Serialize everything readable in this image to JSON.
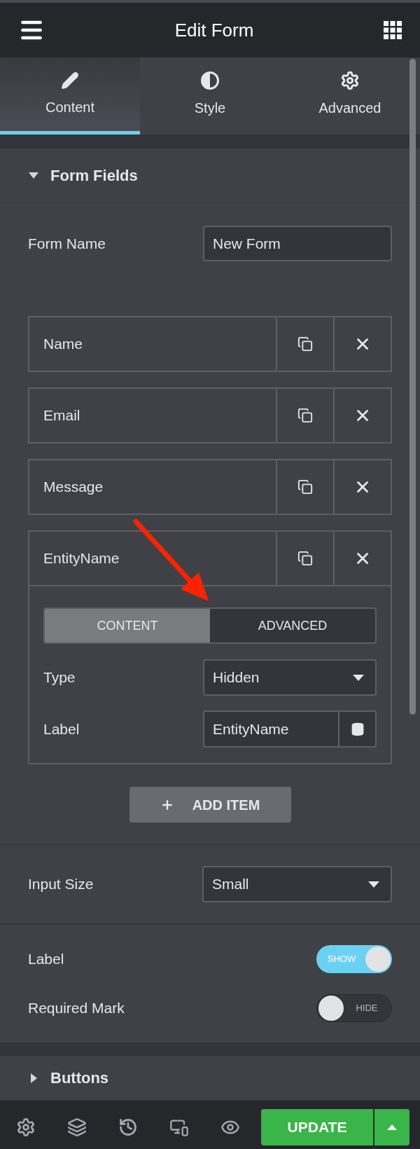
{
  "header": {
    "title": "Edit Form"
  },
  "tabs": [
    {
      "label": "Content",
      "kind": "pencil",
      "selected": true
    },
    {
      "label": "Style",
      "kind": "contrast",
      "selected": false
    },
    {
      "label": "Advanced",
      "kind": "gear",
      "selected": false
    }
  ],
  "form_fields": {
    "title": "Form Fields",
    "expanded": true,
    "form_name": {
      "label": "Form Name",
      "value": "New Form"
    },
    "items": [
      {
        "label": "Name",
        "expanded": false
      },
      {
        "label": "Email",
        "expanded": false
      },
      {
        "label": "Message",
        "expanded": false
      },
      {
        "label": "EntityName",
        "expanded": true,
        "tabs": [
          {
            "label": "CONTENT",
            "selected": true
          },
          {
            "label": "ADVANCED",
            "selected": false
          }
        ],
        "type": {
          "label": "Type",
          "value": "Hidden"
        },
        "field_label": {
          "label": "Label",
          "value": "EntityName"
        }
      }
    ],
    "add_button": "ADD ITEM"
  },
  "input_size": {
    "label": "Input Size",
    "value": "Small"
  },
  "switches": [
    {
      "label": "Label",
      "on": true,
      "state_text": "SHOW"
    },
    {
      "label": "Required Mark",
      "on": false,
      "state_text": "HIDE"
    }
  ],
  "buttons_section": {
    "title": "Buttons",
    "expanded": false
  },
  "footer": {
    "update_button": "UPDATE"
  }
}
